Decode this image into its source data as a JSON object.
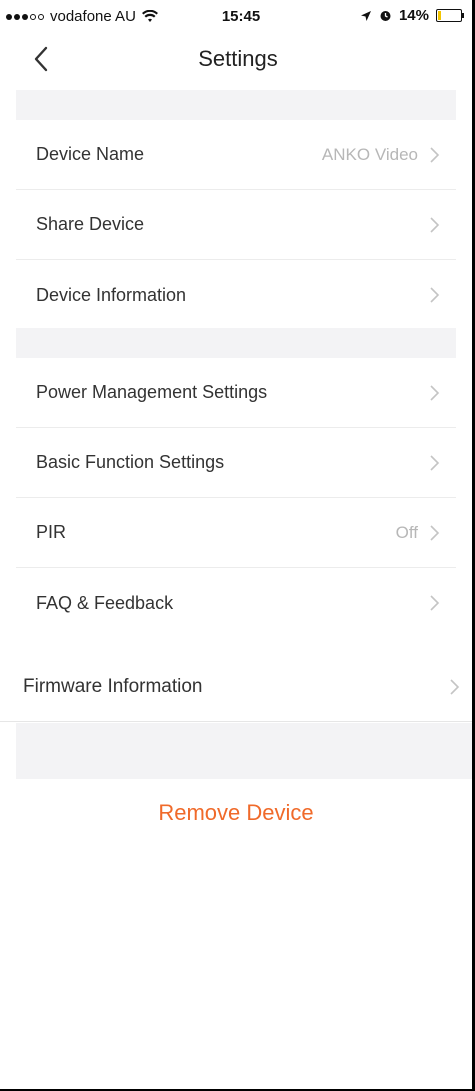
{
  "status_bar": {
    "carrier": "vodafone AU",
    "time": "15:45",
    "battery_percent": "14%",
    "battery_level": 0.14,
    "icons": [
      "signal-dots-icon",
      "wifi-icon",
      "location-arrow-icon",
      "alarm-icon",
      "battery-icon"
    ]
  },
  "nav": {
    "title": "Settings",
    "back_icon": "chevron-left-icon"
  },
  "group1": [
    {
      "label": "Device Name",
      "value": "ANKO Video"
    },
    {
      "label": "Share Device",
      "value": ""
    },
    {
      "label": "Device Information",
      "value": ""
    }
  ],
  "group2": [
    {
      "label": "Power Management Settings",
      "value": ""
    },
    {
      "label": "Basic Function Settings",
      "value": ""
    },
    {
      "label": "PIR",
      "value": "Off"
    },
    {
      "label": "FAQ & Feedback",
      "value": ""
    }
  ],
  "firmware": {
    "label": "Firmware Information"
  },
  "actions": {
    "remove_label": "Remove Device",
    "remove_color": "#f06a2a"
  },
  "colors": {
    "section_gap": "#f3f3f5",
    "separator": "#ececec",
    "value_text": "#b7b7b7"
  }
}
